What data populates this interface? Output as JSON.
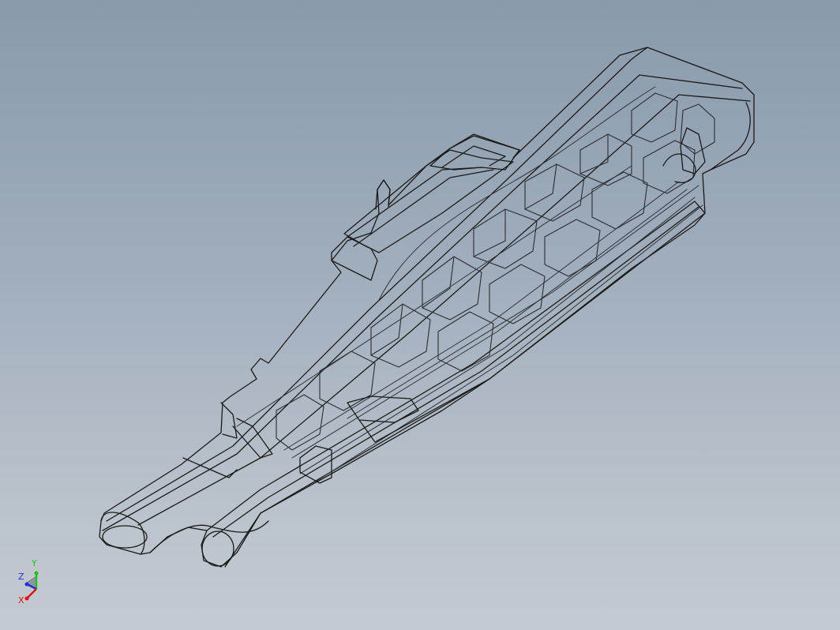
{
  "viewport": {
    "background_top": "#8a9aab",
    "background_bottom": "#c4cad1",
    "edge_color": "#1a1a1a",
    "hidden_edge_color": "#3a3f46"
  },
  "triad": {
    "x_label": "X",
    "y_label": "Y",
    "z_label": "Z",
    "x_color": "#e01010",
    "y_color": "#20c020",
    "z_color": "#2030e0"
  }
}
